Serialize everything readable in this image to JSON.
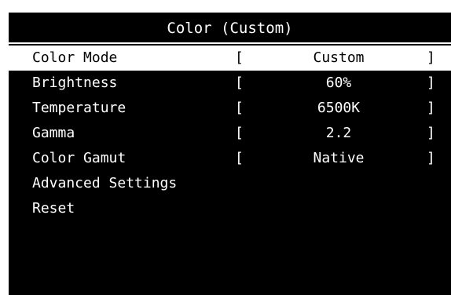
{
  "osd": {
    "title": "Color (Custom)",
    "items": [
      {
        "label": "Color Mode",
        "bracket_open": "[",
        "value": "Custom",
        "bracket_close": "]",
        "selected": true
      },
      {
        "label": "Brightness",
        "bracket_open": "[",
        "value": "60%",
        "bracket_close": "]",
        "selected": false
      },
      {
        "label": "Temperature",
        "bracket_open": "[",
        "value": "6500K",
        "bracket_close": "]",
        "selected": false
      },
      {
        "label": "Gamma",
        "bracket_open": "[",
        "value": "2.2",
        "bracket_close": "]",
        "selected": false
      },
      {
        "label": "Color Gamut",
        "bracket_open": "[",
        "value": "Native",
        "bracket_close": "]",
        "selected": false
      },
      {
        "label": "Advanced Settings",
        "selected": false
      },
      {
        "label": "Reset",
        "selected": false
      }
    ],
    "colors": {
      "background": "#000000",
      "text": "#ffffff",
      "highlight": "#ffffff",
      "highlight_text": "#000000"
    }
  }
}
